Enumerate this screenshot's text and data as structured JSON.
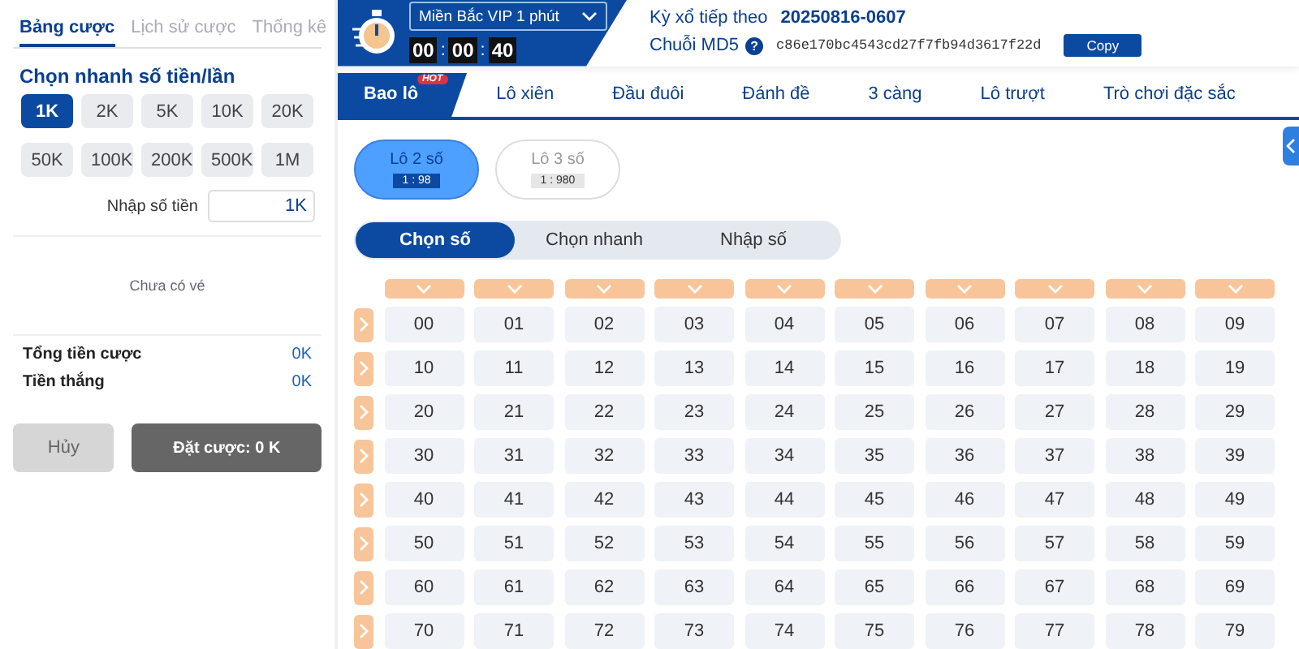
{
  "bet_panel": {
    "tabs": [
      {
        "label": "Bảng cược",
        "selected": true
      },
      {
        "label": "Lịch sử cược",
        "selected": false
      },
      {
        "label": "Thống kê",
        "selected": false
      }
    ],
    "amount_title": "Chọn nhanh số tiền/lần",
    "amounts": [
      {
        "label": "1K",
        "selected": true
      },
      {
        "label": "2K",
        "selected": false
      },
      {
        "label": "5K",
        "selected": false
      },
      {
        "label": "10K",
        "selected": false
      },
      {
        "label": "20K",
        "selected": false
      },
      {
        "label": "50K",
        "selected": false
      },
      {
        "label": "100K",
        "selected": false
      },
      {
        "label": "200K",
        "selected": false
      },
      {
        "label": "500K",
        "selected": false
      },
      {
        "label": "1M",
        "selected": false
      }
    ],
    "amount_input": {
      "label": "Nhập số tiền",
      "value": "1K"
    },
    "empty_text": "Chưa có vé",
    "totals": [
      {
        "label": "Tổng tiền cược",
        "value": "0K"
      },
      {
        "label": "Tiền thắng",
        "value": "0K"
      }
    ],
    "cancel_button": "Hủy",
    "submit_button": "Đặt cược: 0 K"
  },
  "header": {
    "game": "Miền Bắc VIP 1 phút",
    "timer": [
      "00",
      "00",
      "40"
    ],
    "timer_separator": ":",
    "next_draw_label": "Kỳ xổ tiếp theo",
    "next_draw": "20250816-0607",
    "md5_label": "Chuỗi MD5",
    "md5_help": "?",
    "md5": "c86e170bc4543cd27f7fb94d3617f22d",
    "copy_button": "Copy"
  },
  "game_tabs": [
    {
      "label": "Bao lô",
      "selected": true,
      "badge": "HOT"
    },
    {
      "label": "Lô xiên",
      "selected": false
    },
    {
      "label": "Đầu đuôi",
      "selected": false
    },
    {
      "label": "Đánh đề",
      "selected": false
    },
    {
      "label": "3 càng",
      "selected": false
    },
    {
      "label": "Lô trượt",
      "selected": false
    },
    {
      "label": "Trò chơi đặc sắc",
      "selected": false
    }
  ],
  "bet_types": [
    {
      "label": "Lô 2 số",
      "odds": "1 : 98",
      "selected": true
    },
    {
      "label": "Lô 3 số",
      "odds": "1 : 980",
      "selected": false
    }
  ],
  "modes": [
    {
      "label": "Chọn số",
      "selected": true
    },
    {
      "label": "Chọn nhanh",
      "selected": false
    },
    {
      "label": "Nhập số",
      "selected": false
    }
  ],
  "number_rows": [
    [
      "00",
      "01",
      "02",
      "03",
      "04",
      "05",
      "06",
      "07",
      "08",
      "09"
    ],
    [
      "10",
      "11",
      "12",
      "13",
      "14",
      "15",
      "16",
      "17",
      "18",
      "19"
    ],
    [
      "20",
      "21",
      "22",
      "23",
      "24",
      "25",
      "26",
      "27",
      "28",
      "29"
    ],
    [
      "30",
      "31",
      "32",
      "33",
      "34",
      "35",
      "36",
      "37",
      "38",
      "39"
    ],
    [
      "40",
      "41",
      "42",
      "43",
      "44",
      "45",
      "46",
      "47",
      "48",
      "49"
    ],
    [
      "50",
      "51",
      "52",
      "53",
      "54",
      "55",
      "56",
      "57",
      "58",
      "59"
    ],
    [
      "60",
      "61",
      "62",
      "63",
      "64",
      "65",
      "66",
      "67",
      "68",
      "69"
    ],
    [
      "70",
      "71",
      "72",
      "73",
      "74",
      "75",
      "76",
      "77",
      "78",
      "79"
    ]
  ]
}
